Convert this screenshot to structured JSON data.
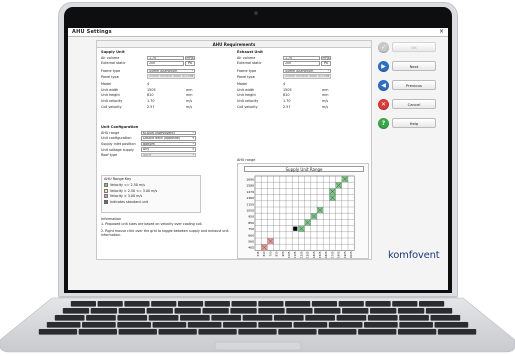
{
  "window": {
    "title": "AHU Settings",
    "close": "×"
  },
  "requirements_title": "AHU Requirements",
  "supply": {
    "heading": "Supply Unit",
    "air_volume": {
      "label": "Air volume",
      "value": "1.70",
      "unit": "m³/s"
    },
    "external_static": {
      "label": "External static",
      "value": "200",
      "unit": "Pa"
    },
    "frame_type": {
      "label": "Frame type",
      "value": "45mm Aluminium"
    },
    "panel_type": {
      "label": "Panel type",
      "value": "45mm mineral wool (EU36"
    },
    "model": {
      "label": "Model",
      "value": "4"
    },
    "unit_width": {
      "label": "Unit width",
      "value": "1505",
      "unit": "mm"
    },
    "unit_height": {
      "label": "Unit height",
      "value": "810",
      "unit": "mm"
    },
    "coil_velocity1": {
      "label": "Unit velocity",
      "value": "1.70",
      "unit": "m/s"
    },
    "coil_velocity2": {
      "label": "Coil velocity",
      "value": "2.57",
      "unit": "m/s"
    }
  },
  "exhaust": {
    "heading": "Exhaust Unit",
    "air_volume": {
      "label": "Air volume",
      "value": "1.70",
      "unit": "m³/s"
    },
    "external_static": {
      "label": "External static",
      "value": "200",
      "unit": "Pa"
    },
    "frame_type": {
      "label": "Frame type",
      "value": "45mm Aluminium"
    },
    "panel_type": {
      "label": "Panel type",
      "value": "45mm mineral wool (EU36"
    },
    "model": {
      "label": "Model",
      "value": "4"
    },
    "unit_width": {
      "label": "Unit width",
      "value": "1505",
      "unit": "mm"
    },
    "unit_height": {
      "label": "Unit height",
      "value": "810",
      "unit": "mm"
    },
    "coil_velocity1": {
      "label": "Unit velocity",
      "value": "1.70",
      "unit": "m/s"
    },
    "coil_velocity2": {
      "label": "Coil velocity",
      "value": "2.57",
      "unit": "m/s"
    }
  },
  "config": {
    "heading": "Unit Configuration",
    "ahu_range": {
      "label": "AHU range",
      "value": "KLASIK [Komfovent]"
    },
    "unit_configuration": {
      "label": "Unit configuration",
      "value": "Double deck (opposite)"
    },
    "supply_inlet": {
      "label": "Supply inlet position",
      "value": "Bottom"
    },
    "voltage": {
      "label": "Unit voltage supply",
      "value": "Any"
    },
    "roof_type": {
      "label": "Roof type",
      "value": "None"
    }
  },
  "key": {
    "heading": "AHU Range Key",
    "items": [
      {
        "label": "Velocity <= 2.50 m/s",
        "color": "#7fc58c"
      },
      {
        "label": "Velocity > 2.50 <= 3.00 m/s",
        "color": "#f4f1a0"
      },
      {
        "label": "Velocity > 3.00 m/s",
        "color": "#e99a9a"
      },
      {
        "label": "Indicates standard unit",
        "color": "#ffffff"
      }
    ]
  },
  "info": {
    "heading": "Information",
    "line1": "1.  Proposed unit sizes are based on velocity over cooling coil.",
    "line2": "2.  Right mouse click over the grid to toggle between supply and exhaust unit information."
  },
  "range": {
    "label": "AHU range",
    "title": "Supply Unit Range",
    "y_labels": [
      "1690",
      "1580",
      "1470",
      "1360",
      "1155",
      "1050",
      "950",
      "850",
      "750",
      "660",
      "560",
      "465"
    ],
    "x_labels": [
      "515",
      "610",
      "700",
      "810",
      "905",
      "1005",
      "1105",
      "1205",
      "1305",
      "1405",
      "1505",
      "1605",
      "1705",
      "1805",
      "1905",
      "2005"
    ],
    "green_cells": [
      [
        0,
        14
      ],
      [
        1,
        13
      ],
      [
        2,
        12
      ],
      [
        3,
        12
      ],
      [
        5,
        10
      ],
      [
        6,
        9
      ],
      [
        7,
        8
      ],
      [
        8,
        7
      ]
    ],
    "red_cells": [
      [
        10,
        2
      ],
      [
        11,
        1
      ]
    ],
    "black_cell": [
      8,
      6
    ],
    "colors": {
      "green": "#7fc58c",
      "red": "#e99a9a",
      "black": "#000000"
    }
  },
  "buttons": [
    {
      "label": "OK",
      "icon": "check-icon",
      "color": "#c9c9c9",
      "disabled": true
    },
    {
      "label": "Next",
      "icon": "arrow-right-icon",
      "color": "#2d6fc0",
      "disabled": false
    },
    {
      "label": "Previous",
      "icon": "arrow-left-icon",
      "color": "#2d6fc0",
      "disabled": false
    },
    {
      "label": "Cancel",
      "icon": "cancel-icon",
      "color": "#d83a3a",
      "disabled": false
    },
    {
      "label": "Help",
      "icon": "help-icon",
      "color": "#3aa54a",
      "disabled": false
    }
  ],
  "logo": "komfovent"
}
